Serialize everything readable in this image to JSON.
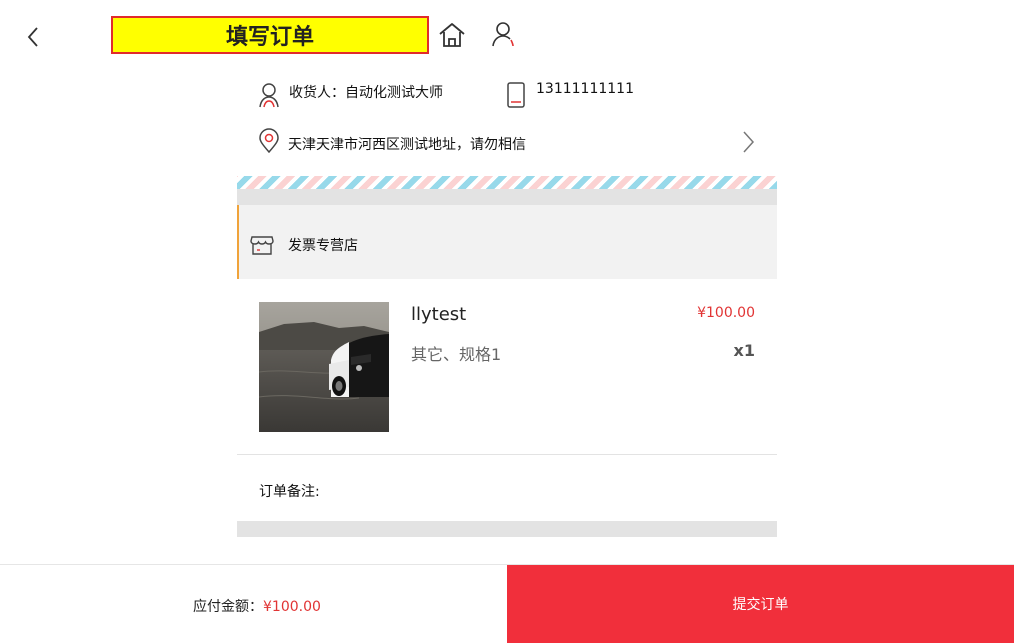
{
  "header": {
    "title": "填写订单",
    "back_icon": "chevron-left-icon",
    "home_icon": "home-icon",
    "user_icon": "user-icon"
  },
  "address": {
    "receiver": "收货人：自动化测试大师",
    "phone": "13111111111",
    "location": "天津天津市河西区测试地址，请勿相信"
  },
  "store": {
    "name": "发票专营店",
    "icon": "store-icon"
  },
  "product": {
    "name": "llytest",
    "price": "¥100.00",
    "spec": "其它、规格1",
    "quantity": "x1"
  },
  "note": {
    "label": "订单备注:"
  },
  "footer": {
    "total_label": "应付金额：",
    "total_value": "¥100.00",
    "submit_label": "提交订单"
  },
  "colors": {
    "accent_red": "#f12f3b",
    "price_red": "#e13434",
    "title_highlight": "#ffff00",
    "store_border": "#f0a33a"
  }
}
